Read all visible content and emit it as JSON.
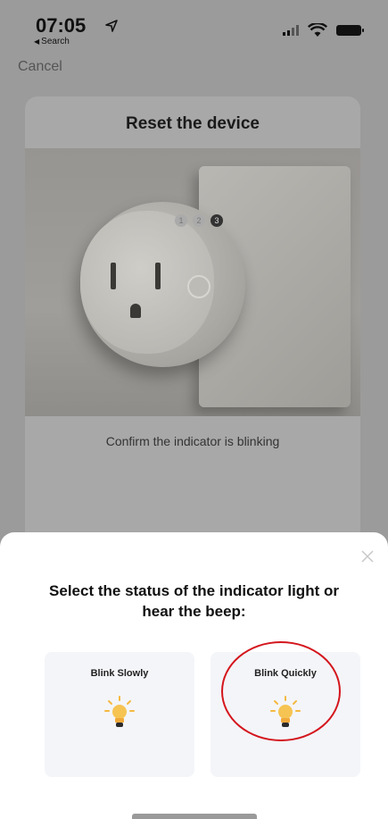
{
  "status_bar": {
    "time": "07:05",
    "back_app": "Search",
    "location_icon": "location-arrow-icon",
    "signal_icon": "cellular-signal-icon",
    "wifi_icon": "wifi-icon",
    "battery_icon": "battery-icon"
  },
  "nav": {
    "cancel_label": "Cancel"
  },
  "reset_card": {
    "title": "Reset the device",
    "steps": [
      "1",
      "2",
      "3"
    ],
    "active_step": "3",
    "confirm_text": "Confirm the indicator is blinking"
  },
  "sheet": {
    "title": "Select the status of the indicator light or hear the beep:",
    "close_icon": "close-icon",
    "options": [
      {
        "label": "Blink Slowly",
        "icon": "light-bulb-icon"
      },
      {
        "label": "Blink Quickly",
        "icon": "light-bulb-icon"
      }
    ]
  },
  "colors": {
    "highlight_ring": "#d4161d",
    "bulb": "#f4b942"
  }
}
